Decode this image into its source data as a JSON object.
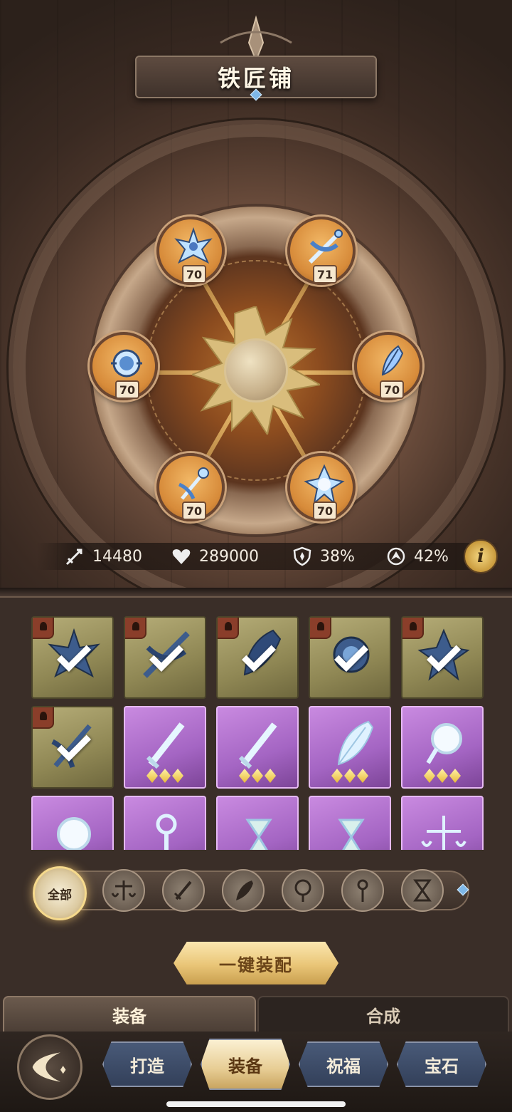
{
  "header": {
    "title": "铁匠铺"
  },
  "slots": [
    {
      "name": "top-left",
      "level": "70",
      "icon": "crown-ornament-icon"
    },
    {
      "name": "top-right",
      "level": "71",
      "icon": "ribbon-sword-icon"
    },
    {
      "name": "mid-left",
      "level": "70",
      "icon": "orb-amulet-icon"
    },
    {
      "name": "mid-right",
      "level": "70",
      "icon": "feather-crest-icon"
    },
    {
      "name": "bottom-left",
      "level": "70",
      "icon": "scepter-icon"
    },
    {
      "name": "bottom-right",
      "level": "70",
      "icon": "crystal-mirror-icon"
    }
  ],
  "stats": {
    "attack": "14480",
    "hp": "289000",
    "defense": "38%",
    "speed": "42%"
  },
  "inventory": {
    "row1": [
      "equipped",
      "equipped",
      "equipped",
      "equipped",
      "equipped"
    ],
    "row2_equipped": "equipped",
    "row2_items": [
      "sword",
      "sword",
      "feather",
      "mirror"
    ],
    "row3_items": [
      "mirror",
      "scepter",
      "hourglass",
      "hourglass",
      "scales"
    ]
  },
  "filters": {
    "all_label": "全部",
    "icons": [
      "scales-icon",
      "sword-icon",
      "feather-icon",
      "mirror-icon",
      "scepter-icon",
      "hourglass-icon"
    ]
  },
  "actions": {
    "one_key_label": "一键装配"
  },
  "subtabs": {
    "equip_label": "装备",
    "synth_label": "合成"
  },
  "nav": {
    "forge_label": "打造",
    "equip_label": "装备",
    "bless_label": "祝福",
    "gem_label": "宝石"
  },
  "colors": {
    "accent_gold": "#e9c577",
    "rare_purple": "#a465c3",
    "epic_olive": "#8f8754"
  }
}
